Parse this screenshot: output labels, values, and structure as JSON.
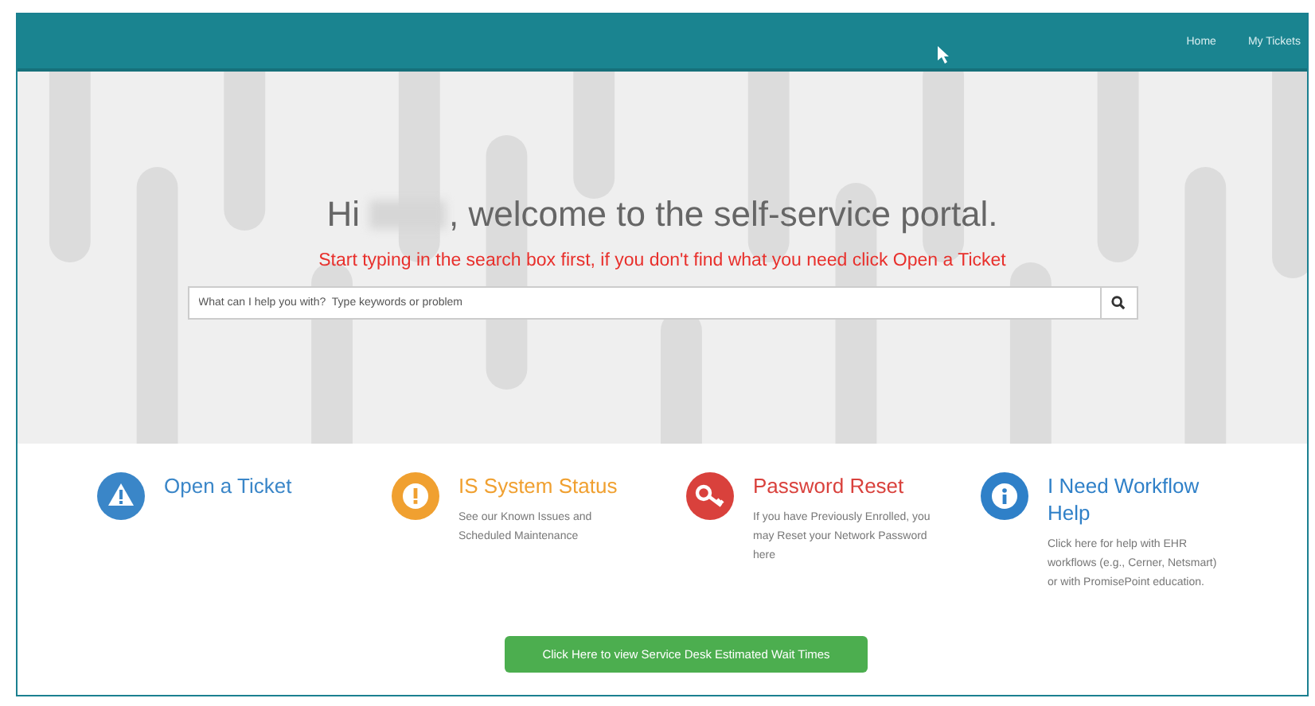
{
  "nav": {
    "links": [
      "Home",
      "My Tickets"
    ]
  },
  "hero": {
    "greeting": "Hi",
    "title": ", welcome to the self-service portal.",
    "subtitle": "Start typing in the search box first, if you don't find what you need click Open a Ticket",
    "search": {
      "placeholder": "What can I help you with?  Type keywords or problem"
    }
  },
  "tiles": [
    {
      "kind": "warning",
      "title": "Open a Ticket",
      "color": "#3a86c8"
    },
    {
      "kind": "alert",
      "title": "IS System Status",
      "text": "See our Known Issues and Scheduled Maintenance",
      "color": "#f0a030"
    },
    {
      "kind": "key",
      "title": "Password Reset",
      "text": "If you have Previously Enrolled, you may Reset your Network Password here",
      "color": "#d9413c"
    },
    {
      "kind": "info",
      "title": "I Need Workflow Help",
      "text": "Click here for help with EHR workflows (e.g., Cerner, Netsmart) or with PromisePoint education.",
      "color": "#2f80c8"
    }
  ],
  "wait_button": "Click Here to view Service Desk Estimated Wait Times"
}
